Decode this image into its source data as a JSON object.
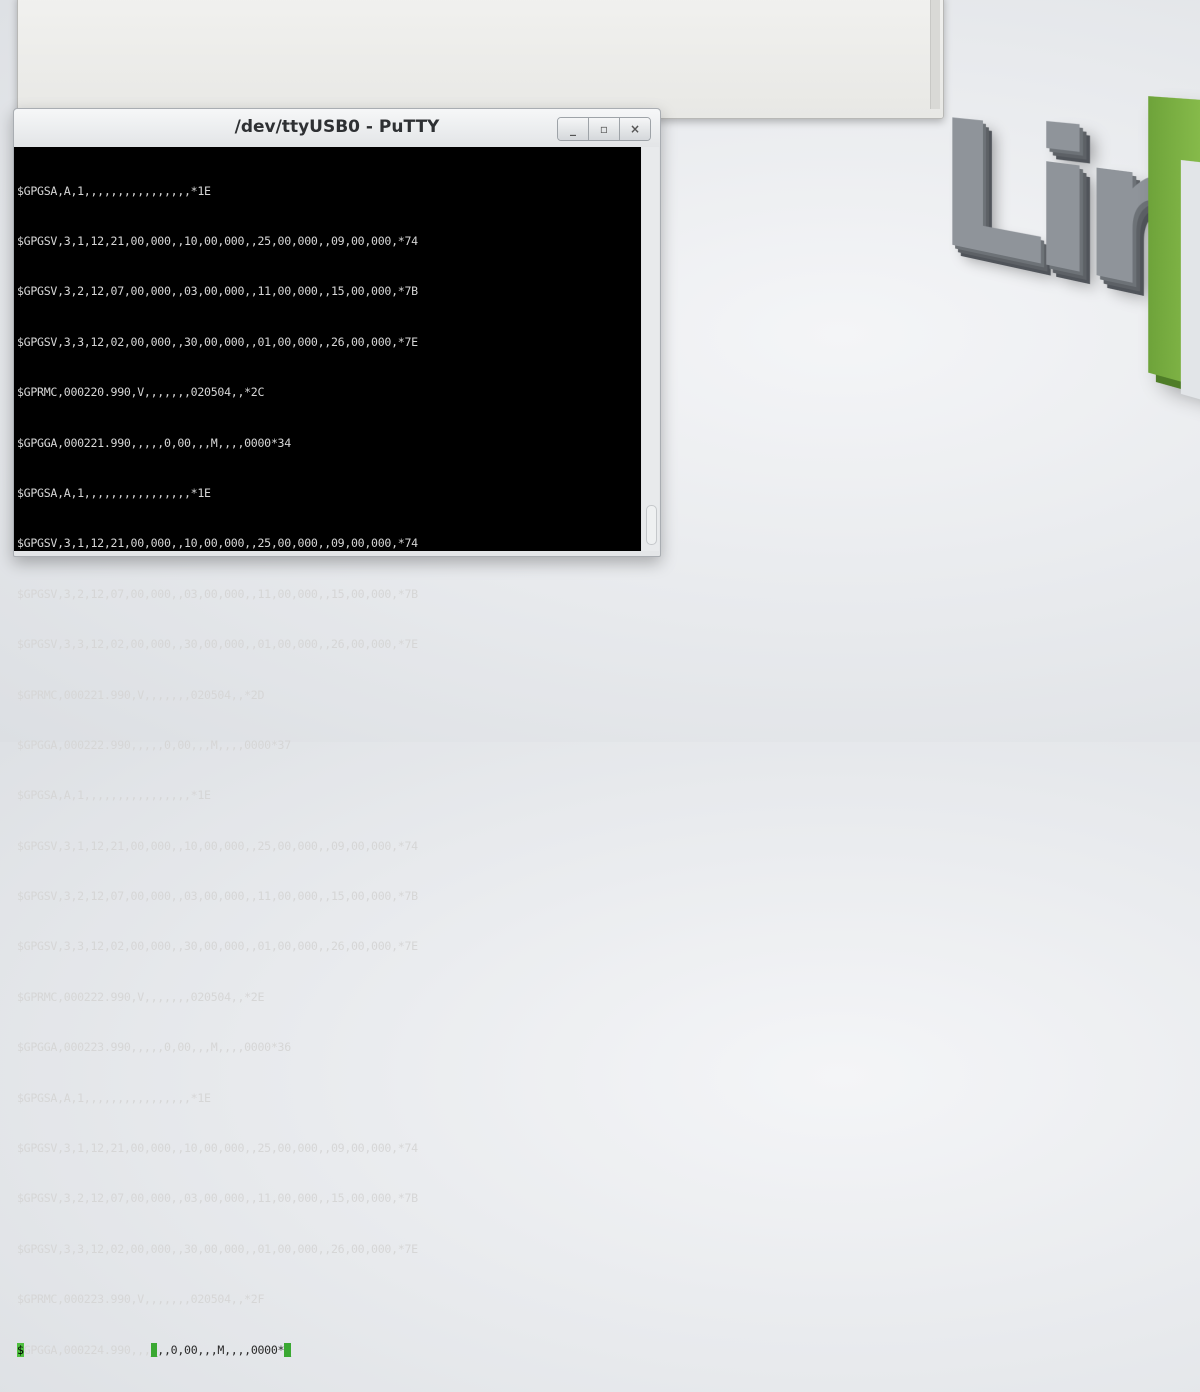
{
  "desktop": {
    "logo_text": "LinuxMint"
  },
  "putty": {
    "title": "/dev/ttyUSB0 - PuTTY",
    "buttons": {
      "minimize": "_",
      "maximize": "▫",
      "close": "×"
    },
    "terminal_lines": [
      "$GPGSA,A,1,,,,,,,,,,,,,,,,*1E",
      "$GPGSV,3,1,12,21,00,000,,10,00,000,,25,00,000,,09,00,000,*74",
      "$GPGSV,3,2,12,07,00,000,,03,00,000,,11,00,000,,15,00,000,*7B",
      "$GPGSV,3,3,12,02,00,000,,30,00,000,,01,00,000,,26,00,000,*7E",
      "$GPRMC,000220.990,V,,,,,,,020504,,*2C",
      "$GPGGA,000221.990,,,,,0,00,,,M,,,,0000*34",
      "$GPGSA,A,1,,,,,,,,,,,,,,,,*1E",
      "$GPGSV,3,1,12,21,00,000,,10,00,000,,25,00,000,,09,00,000,*74",
      "$GPGSV,3,2,12,07,00,000,,03,00,000,,11,00,000,,15,00,000,*7B",
      "$GPGSV,3,3,12,02,00,000,,30,00,000,,01,00,000,,26,00,000,*7E",
      "$GPRMC,000221.990,V,,,,,,,020504,,*2D",
      "$GPGGA,000222.990,,,,,0,00,,,M,,,,0000*37",
      "$GPGSA,A,1,,,,,,,,,,,,,,,,*1E",
      "$GPGSV,3,1,12,21,00,000,,10,00,000,,25,00,000,,09,00,000,*74",
      "$GPGSV,3,2,12,07,00,000,,03,00,000,,11,00,000,,15,00,000,*7B",
      "$GPGSV,3,3,12,02,00,000,,30,00,000,,01,00,000,,26,00,000,*7E",
      "$GPRMC,000222.990,V,,,,,,,020504,,*2E",
      "$GPGGA,000223.990,,,,,0,00,,,M,,,,0000*36",
      "$GPGSA,A,1,,,,,,,,,,,,,,,,*1E",
      "$GPGSV,3,1,12,21,00,000,,10,00,000,,25,00,000,,09,00,000,*74",
      "$GPGSV,3,2,12,07,00,000,,03,00,000,,11,00,000,,15,00,000,*7B",
      "$GPGSV,3,3,12,02,00,000,,30,00,000,,01,00,000,,26,00,000,*7E",
      "$GPRMC,000223.990,V,,,,,,,020504,,*2F"
    ],
    "current_line": {
      "first_char": "$",
      "text": "GPGGA,000224.990,,,",
      "ghost_text": ",,0,00,,,M,,,,0000*"
    }
  },
  "colors": {
    "terminal_bg": "#000000",
    "terminal_fg": "#d6d6d6",
    "cursor": "#3aa832",
    "mint_green": "#8cc04e"
  }
}
